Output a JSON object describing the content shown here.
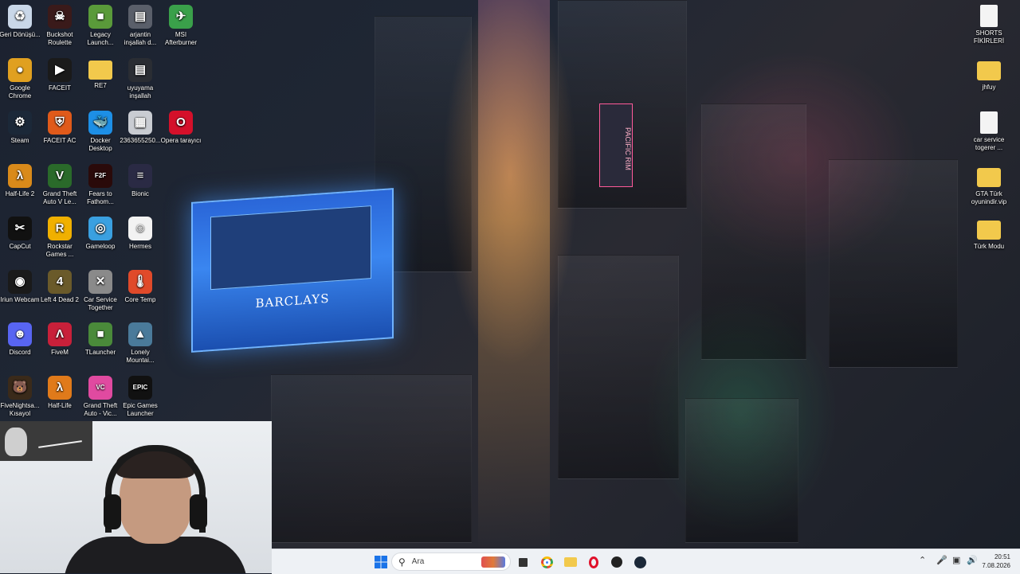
{
  "desktop": {
    "icons": [
      {
        "label": "Geri Dönüşü...",
        "icon": "recycle-bin-icon",
        "color": "#c9d7e8"
      },
      {
        "label": "Buckshot Roulette",
        "icon": "buckshot-roulette-icon",
        "color": "#3a1a1a"
      },
      {
        "label": "Legacy Launch...",
        "icon": "legacy-launcher-icon",
        "color": "#5a9a3a"
      },
      {
        "label": "arjantin inşallah d...",
        "icon": "video-file-icon",
        "color": "#5a5f6a"
      },
      {
        "label": "MSI Afterburner",
        "icon": "msi-afterburner-icon",
        "color": "#3aa04a"
      },
      {
        "label": "Google Chrome",
        "icon": "chrome-icon",
        "color": "#e0a020"
      },
      {
        "label": "FACEIT",
        "icon": "faceit-icon",
        "color": "#1a1a1a"
      },
      {
        "label": "RE7",
        "icon": "folder-icon",
        "color": "#f2c94c"
      },
      {
        "label": "uyuyama inşallah",
        "icon": "video-file-icon",
        "color": "#2a2d33"
      },
      {
        "label": "Steam",
        "icon": "steam-icon",
        "color": "#1b2838"
      },
      {
        "label": "FACEIT AC",
        "icon": "faceit-ac-icon",
        "color": "#e05a1a"
      },
      {
        "label": "Docker Desktop",
        "icon": "docker-icon",
        "color": "#1d8fe6"
      },
      {
        "label": "2363655250...",
        "icon": "image-file-icon",
        "color": "#c9ccd2"
      },
      {
        "label": "Opera tarayıcı",
        "icon": "opera-icon",
        "color": "#d4102a"
      },
      {
        "label": "Half-Life 2",
        "icon": "half-life-2-icon",
        "color": "#d98a1a"
      },
      {
        "label": "Grand Theft Auto V Le...",
        "icon": "gta-v-icon",
        "color": "#2a6a2a"
      },
      {
        "label": "Fears to Fathom...",
        "icon": "fears-to-fathom-icon",
        "color": "#2a0a0a"
      },
      {
        "label": "Bionic",
        "icon": "bionic-icon",
        "color": "#2a2a44"
      },
      {
        "label": "CapCut",
        "icon": "capcut-icon",
        "color": "#111111"
      },
      {
        "label": "Rockstar Games ...",
        "icon": "rockstar-icon",
        "color": "#f0b000"
      },
      {
        "label": "Gameloop",
        "icon": "gameloop-icon",
        "color": "#3aa0e0"
      },
      {
        "label": "Hermes",
        "icon": "hermes-icon",
        "color": "#f2f2f2"
      },
      {
        "label": "Iriun Webcam",
        "icon": "iriun-webcam-icon",
        "color": "#1a1a1a"
      },
      {
        "label": "Left 4 Dead 2",
        "icon": "left-4-dead-2-icon",
        "color": "#6a5a2a"
      },
      {
        "label": "Car Service Together",
        "icon": "car-service-together-icon",
        "color": "#8a8a8a"
      },
      {
        "label": "Core Temp",
        "icon": "core-temp-icon",
        "color": "#e04a2a"
      },
      {
        "label": "Discord",
        "icon": "discord-icon",
        "color": "#5865f2"
      },
      {
        "label": "FiveM",
        "icon": "fivem-icon",
        "color": "#c8203a"
      },
      {
        "label": "TLauncher",
        "icon": "tlauncher-icon",
        "color": "#4a8a3a"
      },
      {
        "label": "Lonely Mountai...",
        "icon": "lonely-mountains-icon",
        "color": "#4a7a9a"
      },
      {
        "label": "FiveNightsa... Kısayol",
        "icon": "fnaf-icon",
        "color": "#3a2a1a"
      },
      {
        "label": "Half-Life",
        "icon": "half-life-icon",
        "color": "#e07a1a"
      },
      {
        "label": "Grand Theft Auto - Vic...",
        "icon": "gta-vice-city-icon",
        "color": "#e04aa0"
      },
      {
        "label": "Epic Games Launcher",
        "icon": "epic-games-icon",
        "color": "#111111"
      }
    ],
    "right_icons": [
      {
        "label": "SHORTS FİKİRLERİ",
        "icon": "text-file-icon"
      },
      {
        "label": "jhfuy",
        "icon": "folder-icon"
      },
      {
        "label": "car service togerer ...",
        "icon": "text-file-icon"
      },
      {
        "label": "GTA Türk oyunindir.vip",
        "icon": "folder-icon"
      },
      {
        "label": "Türk Modu",
        "icon": "folder-icon"
      }
    ],
    "wallpaper_sign": "BARCLAYS",
    "billboard_text": "PACIFIC RIM"
  },
  "taskbar": {
    "search_placeholder": "Ara",
    "apps": [
      "start-icon",
      "task-view-icon",
      "chrome-icon",
      "file-explorer-icon",
      "opera-icon",
      "faceit-taskbar-icon",
      "steam-icon"
    ],
    "time": "20:51",
    "date": "7.08.2026"
  }
}
